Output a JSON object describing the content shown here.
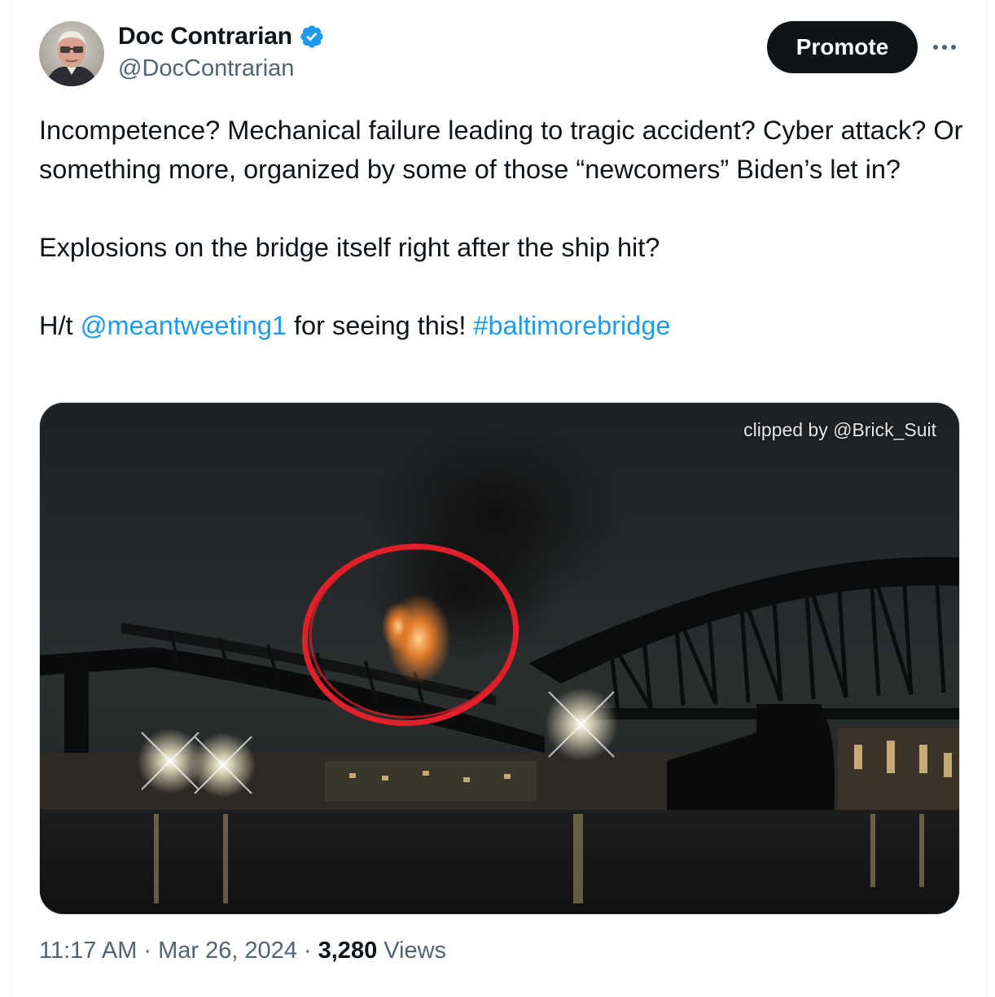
{
  "author": {
    "display_name": "Doc Contrarian",
    "handle": "@DocContrarian",
    "verified": true,
    "verified_icon": "verified-badge-icon"
  },
  "actions": {
    "promote_label": "Promote",
    "more_icon": "more-horizontal-icon"
  },
  "tweet": {
    "paragraph_1": "Incompetence? Mechanical failure leading to tragic accident? Cyber attack? Or something more, organized by some of those “newcomers” Biden’s let in?",
    "paragraph_2": "Explosions on the bridge itself right after the ship hit?",
    "paragraph_3_prefix": "H/t ",
    "mention": "@meantweeting1",
    "paragraph_3_middle": " for seeing this! ",
    "hashtag": "#baltimorebridge"
  },
  "media": {
    "watermark": "clipped by @Brick_Suit"
  },
  "meta": {
    "time": "11:17 AM",
    "separator": "·",
    "date": "Mar 26, 2024",
    "views_count": "3,280",
    "views_label": "Views"
  },
  "colors": {
    "link": "#1d9bf0",
    "verified": "#1d9bf0",
    "text": "#0f1419",
    "secondary": "#536471",
    "promote_bg": "#0f1419",
    "circle_annotation": "#e0202a"
  }
}
